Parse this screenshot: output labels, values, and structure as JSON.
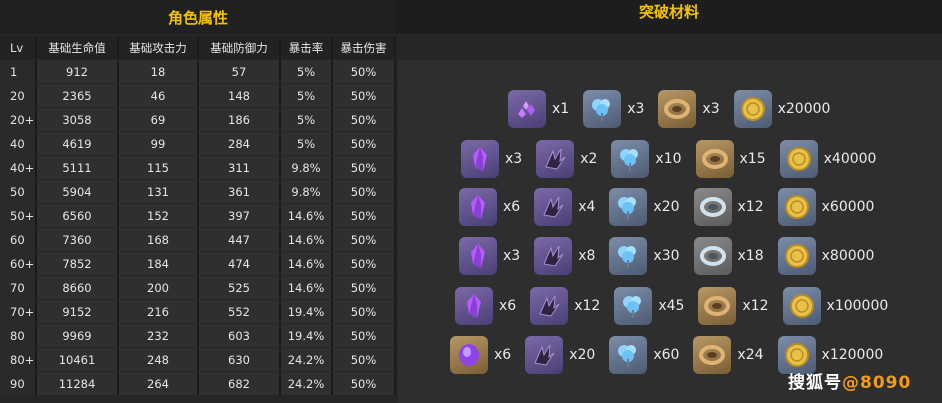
{
  "headers": {
    "stats": "角色属性",
    "materials": "突破材料"
  },
  "stats_table": {
    "columns": [
      "Lv",
      "基础生命值",
      "基础攻击力",
      "基础防御力",
      "暴击率",
      "暴击伤害"
    ],
    "rows": [
      [
        "1",
        "912",
        "18",
        "57",
        "5%",
        "50%"
      ],
      [
        "20",
        "2365",
        "46",
        "148",
        "5%",
        "50%"
      ],
      [
        "20+",
        "3058",
        "69",
        "186",
        "5%",
        "50%"
      ],
      [
        "40",
        "4619",
        "99",
        "284",
        "5%",
        "50%"
      ],
      [
        "40+",
        "5111",
        "115",
        "311",
        "9.8%",
        "50%"
      ],
      [
        "50",
        "5904",
        "131",
        "361",
        "9.8%",
        "50%"
      ],
      [
        "50+",
        "6560",
        "152",
        "397",
        "14.6%",
        "50%"
      ],
      [
        "60",
        "7360",
        "168",
        "447",
        "14.6%",
        "50%"
      ],
      [
        "60+",
        "7852",
        "184",
        "474",
        "14.6%",
        "50%"
      ],
      [
        "70",
        "8660",
        "200",
        "525",
        "14.6%",
        "50%"
      ],
      [
        "70+",
        "9152",
        "216",
        "552",
        "19.4%",
        "50%"
      ],
      [
        "80",
        "9969",
        "232",
        "603",
        "19.4%",
        "50%"
      ],
      [
        "80+",
        "10461",
        "248",
        "630",
        "24.2%",
        "50%"
      ],
      [
        "90",
        "11284",
        "264",
        "682",
        "24.2%",
        "50%"
      ]
    ]
  },
  "materials": [
    [
      {
        "icon": "crystal-cluster-icon",
        "count": "x1"
      },
      {
        "icon": "blue-flower-icon",
        "count": "x3"
      },
      {
        "icon": "bronze-ring-icon",
        "count": "x3"
      },
      {
        "icon": "gold-coin-icon",
        "count": "x20000"
      }
    ],
    [
      {
        "icon": "purple-crystal-icon",
        "count": "x3"
      },
      {
        "icon": "dark-claw-icon",
        "count": "x2"
      },
      {
        "icon": "blue-flower-icon",
        "count": "x10"
      },
      {
        "icon": "bronze-ring-icon",
        "count": "x15"
      },
      {
        "icon": "gold-coin-icon",
        "count": "x40000"
      }
    ],
    [
      {
        "icon": "purple-crystal-icon",
        "count": "x6"
      },
      {
        "icon": "dark-claw-icon",
        "count": "x4"
      },
      {
        "icon": "blue-flower-icon",
        "count": "x20"
      },
      {
        "icon": "silver-ring-icon",
        "count": "x12"
      },
      {
        "icon": "gold-coin-icon",
        "count": "x60000"
      }
    ],
    [
      {
        "icon": "purple-crystal-icon",
        "count": "x3"
      },
      {
        "icon": "dark-claw-icon",
        "count": "x8"
      },
      {
        "icon": "blue-flower-icon",
        "count": "x30"
      },
      {
        "icon": "silver-ring-icon",
        "count": "x18"
      },
      {
        "icon": "gold-coin-icon",
        "count": "x80000"
      }
    ],
    [
      {
        "icon": "purple-crystal-icon",
        "count": "x6"
      },
      {
        "icon": "dark-claw-icon",
        "count": "x12"
      },
      {
        "icon": "blue-flower-icon",
        "count": "x45"
      },
      {
        "icon": "bronze-ring-icon",
        "count": "x12"
      },
      {
        "icon": "gold-coin-icon",
        "count": "x100000"
      }
    ],
    [
      {
        "icon": "purple-gem-icon",
        "count": "x6"
      },
      {
        "icon": "dark-claw-icon",
        "count": "x20"
      },
      {
        "icon": "blue-flower-icon",
        "count": "x60"
      },
      {
        "icon": "bronze-ring-icon",
        "count": "x24"
      },
      {
        "icon": "gold-coin-icon",
        "count": "x120000"
      }
    ]
  ],
  "watermark": {
    "brand": "搜狐号",
    "site": "@8090"
  }
}
